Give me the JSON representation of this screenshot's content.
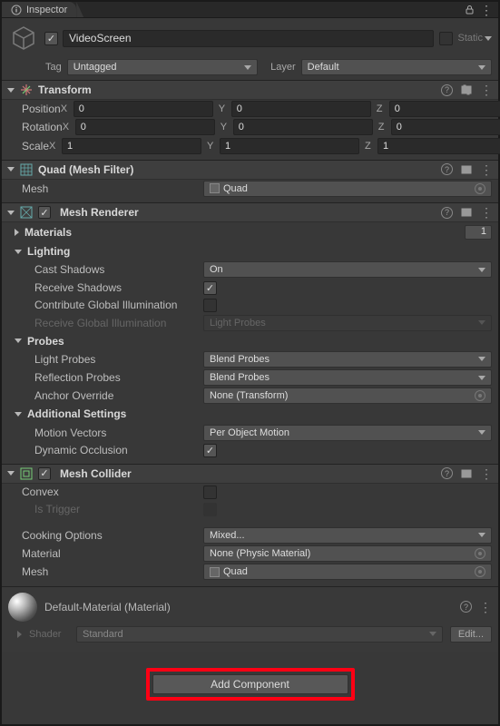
{
  "tab": "Inspector",
  "game_object": {
    "name": "VideoScreen",
    "static_label": "Static",
    "tag_label": "Tag",
    "tag_value": "Untagged",
    "layer_label": "Layer",
    "layer_value": "Default"
  },
  "transform": {
    "title": "Transform",
    "position_label": "Position",
    "rotation_label": "Rotation",
    "scale_label": "Scale",
    "position": {
      "x": "0",
      "y": "0",
      "z": "0"
    },
    "rotation": {
      "x": "0",
      "y": "0",
      "z": "0"
    },
    "scale": {
      "x": "1",
      "y": "1",
      "z": "1"
    }
  },
  "mesh_filter": {
    "title": "Quad (Mesh Filter)",
    "mesh_label": "Mesh",
    "mesh_value": "Quad"
  },
  "mesh_renderer": {
    "title": "Mesh Renderer",
    "materials_label": "Materials",
    "materials_count": "1",
    "lighting_label": "Lighting",
    "cast_shadows_label": "Cast Shadows",
    "cast_shadows_value": "On",
    "receive_shadows_label": "Receive Shadows",
    "contrib_gi_label": "Contribute Global Illumination",
    "receive_gi_label": "Receive Global Illumination",
    "receive_gi_value": "Light Probes",
    "probes_label": "Probes",
    "light_probes_label": "Light Probes",
    "light_probes_value": "Blend Probes",
    "reflection_probes_label": "Reflection Probes",
    "reflection_probes_value": "Blend Probes",
    "anchor_override_label": "Anchor Override",
    "anchor_override_value": "None (Transform)",
    "additional_label": "Additional Settings",
    "motion_vectors_label": "Motion Vectors",
    "motion_vectors_value": "Per Object Motion",
    "dynamic_occlusion_label": "Dynamic Occlusion"
  },
  "mesh_collider": {
    "title": "Mesh Collider",
    "convex_label": "Convex",
    "is_trigger_label": "Is Trigger",
    "cooking_label": "Cooking Options",
    "cooking_value": "Mixed...",
    "material_label": "Material",
    "material_value": "None (Physic Material)",
    "mesh_label": "Mesh",
    "mesh_value": "Quad"
  },
  "material": {
    "title": "Default-Material (Material)",
    "shader_label": "Shader",
    "shader_value": "Standard",
    "edit_label": "Edit..."
  },
  "add_component": "Add Component"
}
